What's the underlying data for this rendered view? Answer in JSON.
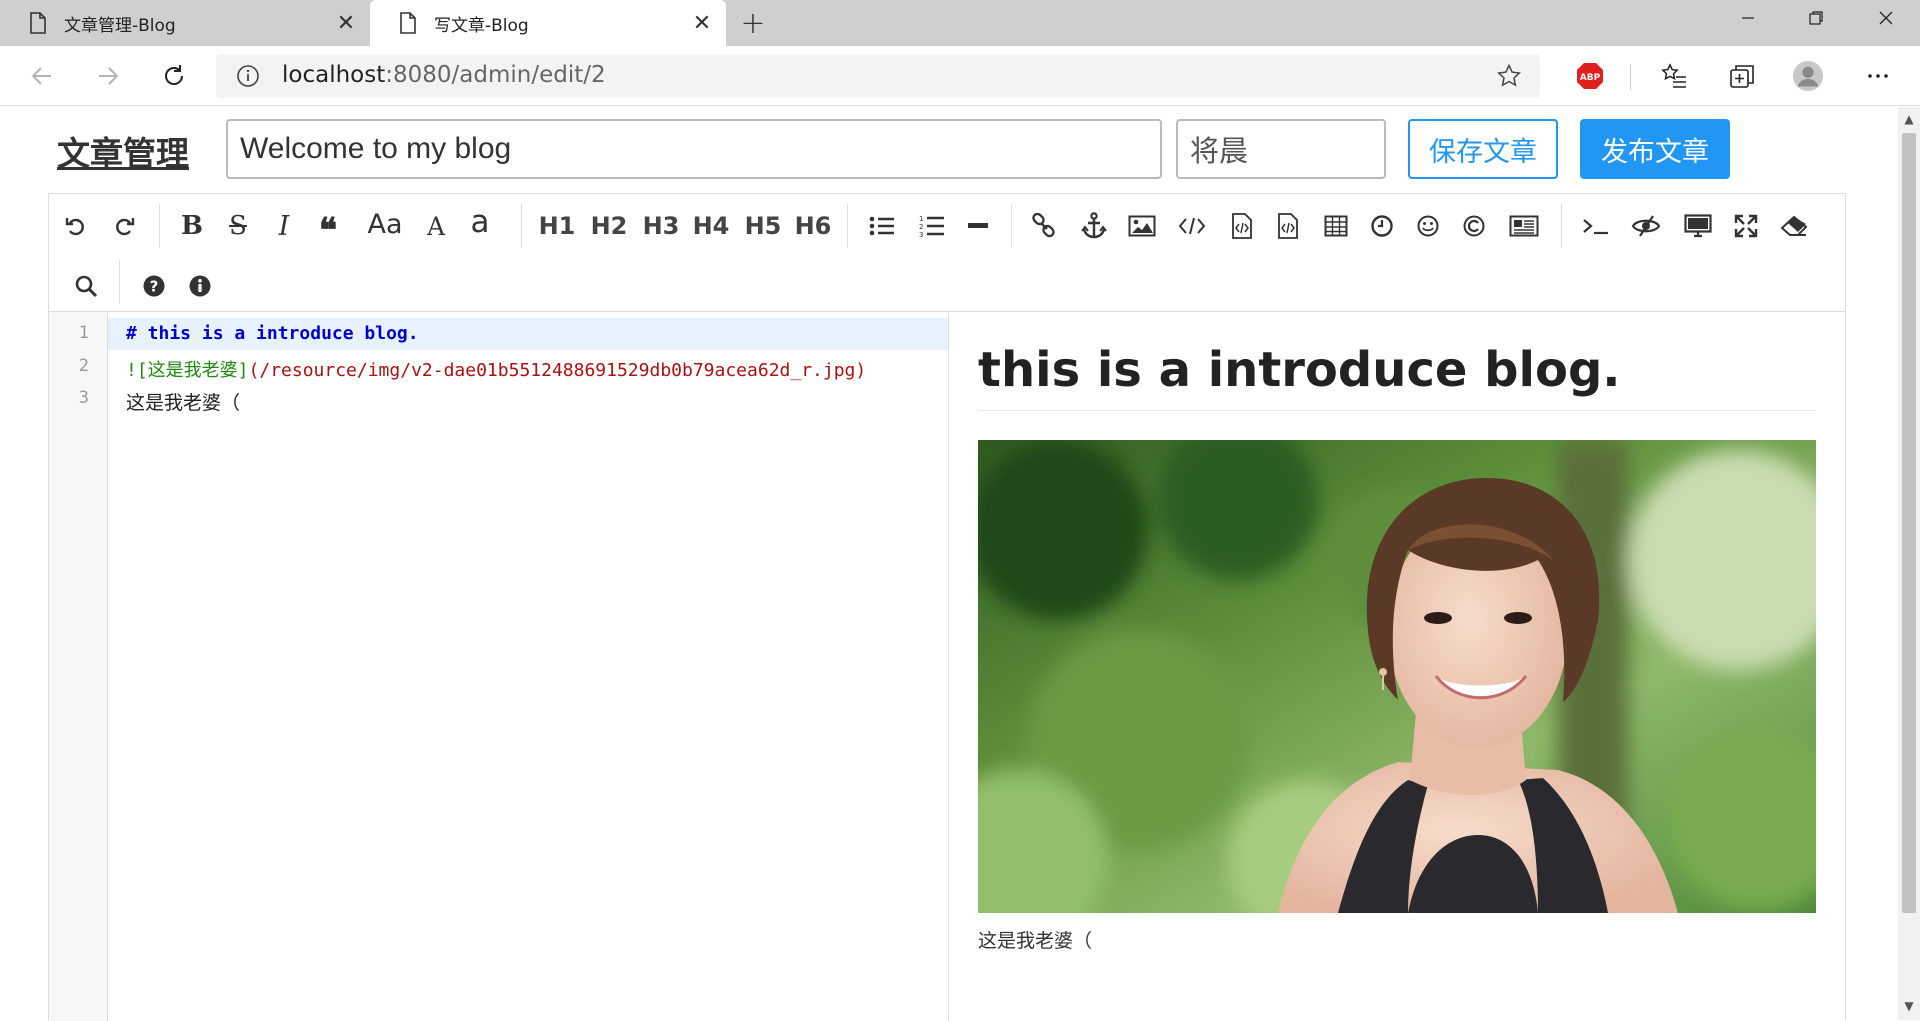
{
  "browser": {
    "tabs": [
      {
        "label": "文章管理-Blog",
        "active": false
      },
      {
        "label": "写文章-Blog",
        "active": true
      }
    ],
    "address": {
      "host": "localhost",
      "rest": ":8080/admin/edit/2"
    },
    "close_glyph": "✕",
    "new_tab_glyph": "+"
  },
  "header": {
    "title": "文章管理",
    "article_title_value": "Welcome to my blog",
    "author_value": "将晨",
    "save_label": "保存文章",
    "publish_label": "发布文章"
  },
  "toolbar": {
    "case_upper": "Aa",
    "case_big": "A",
    "case_small": "a",
    "headings": [
      "H1",
      "H2",
      "H3",
      "H4",
      "H5",
      "H6"
    ]
  },
  "code": {
    "line_numbers": [
      "1",
      "2",
      "3"
    ],
    "line1": "# this is a introduce blog.",
    "line2_alt": "![这是我老婆]",
    "line2_url": "(/resource/img/v2-dae01b5512488691529db0b79acea62d_r.jpg)",
    "line3": "这是我老婆（"
  },
  "preview": {
    "heading": "this is a introduce blog.",
    "caption": "这是我老婆（"
  },
  "colors": {
    "accent": "#2196f3",
    "md_header": "#0000cc",
    "md_link_text": "#228811",
    "md_url": "#aa1111",
    "active_line": "#e8f2ff"
  }
}
